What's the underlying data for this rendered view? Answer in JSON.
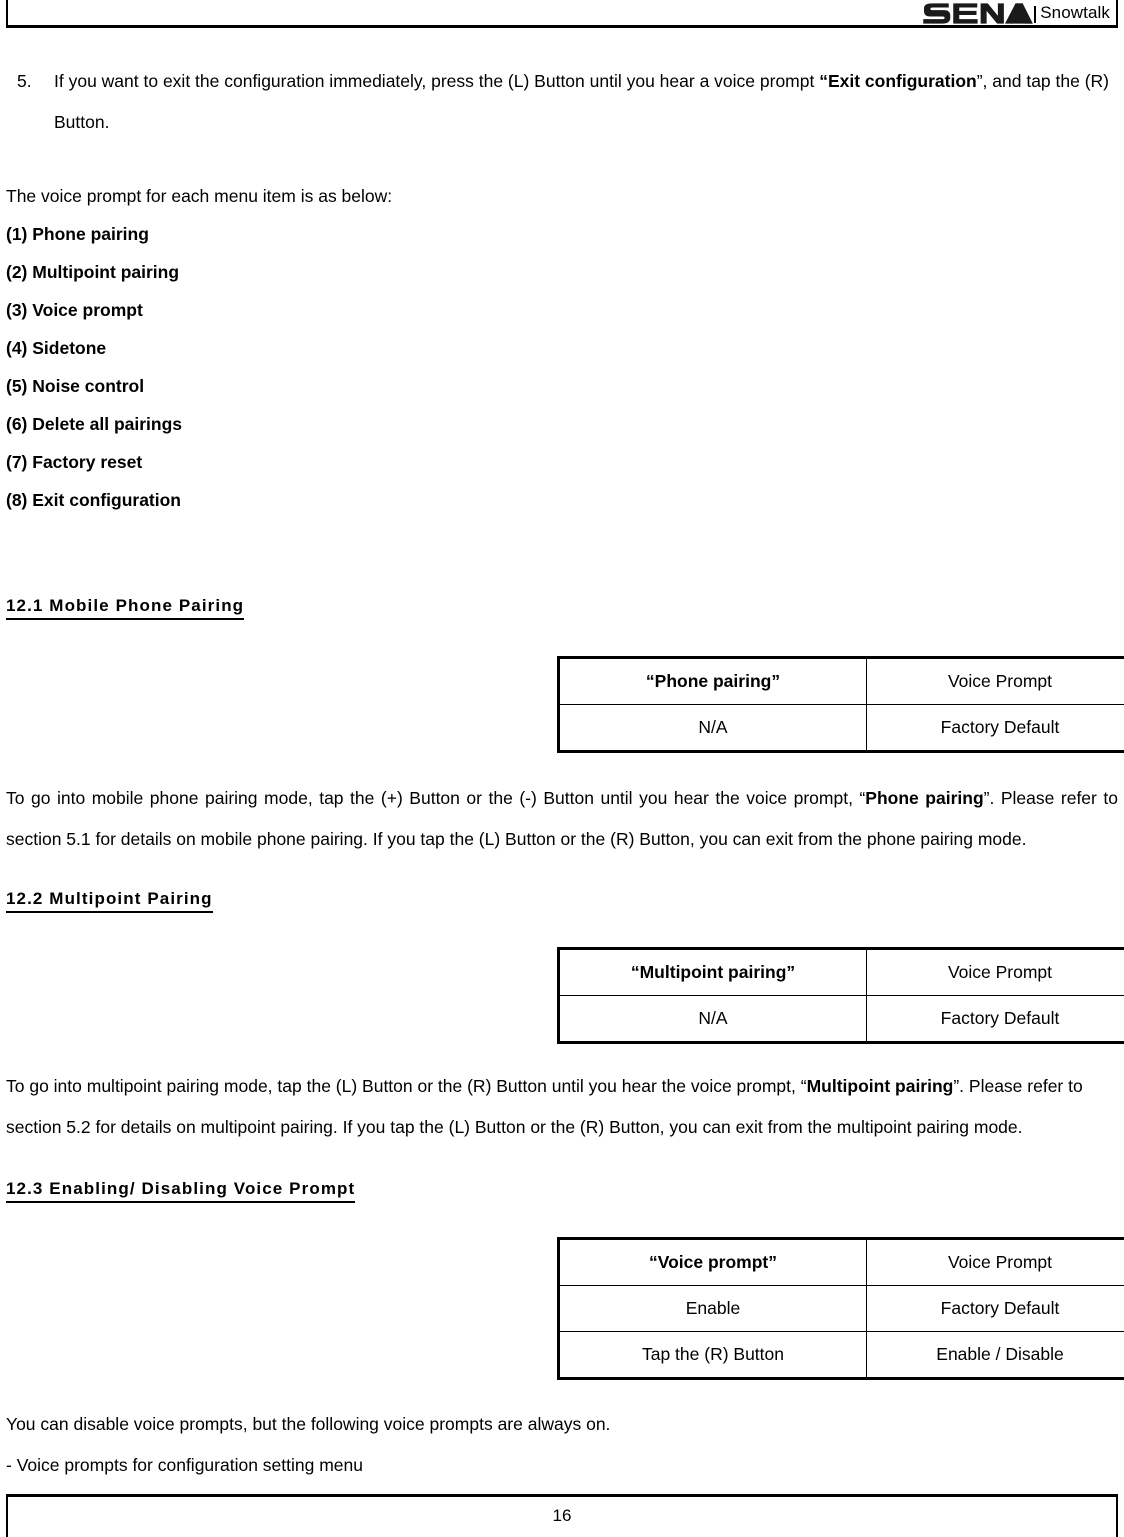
{
  "header": {
    "logo_text": "SENA",
    "brand": "Snowtalk",
    "logo_icon": "sena-wordmark-logo"
  },
  "step": {
    "number": "5.",
    "text_before": "If you want to exit the configuration immediately, press the (L) Button until you hear a voice prompt ",
    "quote_open": "“Exit configuration",
    "quote_close": "”",
    "text_after": ", and tap the (R) Button."
  },
  "intro": "The voice prompt for each menu item is as below:",
  "menu_items": [
    "(1) Phone pairing",
    "(2) Multipoint pairing",
    "(3) Voice prompt",
    "(4) Sidetone",
    "(5) Noise control",
    "(6) Delete all pairings",
    "(7) Factory reset",
    "(8) Exit configuration"
  ],
  "sections": [
    {
      "heading": "12.1 Mobile Phone Pairing",
      "table": {
        "rows": [
          {
            "label": "“Phone pairing”",
            "value": "Voice Prompt",
            "label_bold": true
          },
          {
            "label": "N/A",
            "value": "Factory Default",
            "label_bold": false
          }
        ]
      },
      "paragraph": {
        "part1": "To go into mobile phone pairing mode, tap the (+) Button or the (-) Button until you hear the voice prompt, “",
        "bold1": "Phone pairing",
        "part2": "”. Please refer to section 5.1 for details on mobile phone pairing. If you tap the (L) Button or the (R) Button, you can exit from the phone pairing mode."
      }
    },
    {
      "heading": "12.2 Multipoint Pairing",
      "table": {
        "rows": [
          {
            "label": "“Multipoint pairing”",
            "value": "Voice Prompt",
            "label_bold": true
          },
          {
            "label": "N/A",
            "value": "Factory Default",
            "label_bold": false
          }
        ]
      },
      "paragraph": {
        "part1": "To go into multipoint pairing mode, tap the (L) Button or the (R) Button until you hear the voice prompt, “",
        "bold1": "Multipoint pairing",
        "part2": "”. Please refer to section 5.2 for details on multipoint pairing. If you tap the (L) Button or the (R) Button, you can exit from the multipoint pairing mode."
      }
    },
    {
      "heading": "12.3 Enabling/ Disabling Voice Prompt",
      "table": {
        "rows": [
          {
            "label": "“Voice prompt”",
            "value": "Voice Prompt",
            "label_bold": true
          },
          {
            "label": "Enable",
            "value": "Factory Default",
            "label_bold": false
          },
          {
            "label": "Tap the (R) Button",
            "value": "Enable / Disable",
            "label_bold": false
          }
        ]
      }
    }
  ],
  "notes": {
    "line1": "You can disable voice prompts, but the following voice prompts are always on.",
    "line2": "- Voice prompts for configuration setting menu"
  },
  "footer": {
    "page_number": "16"
  }
}
